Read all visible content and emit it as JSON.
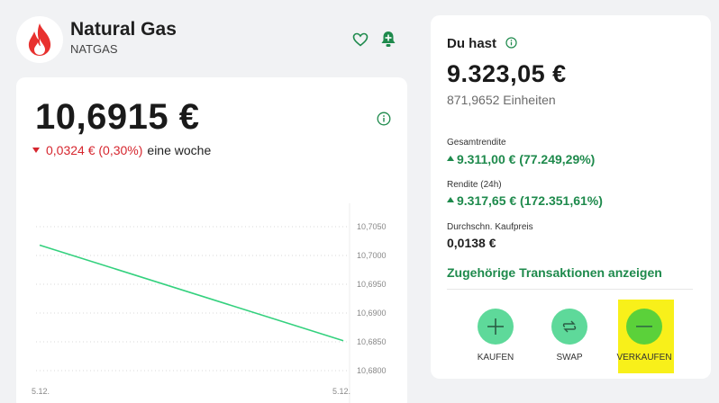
{
  "asset": {
    "name": "Natural Gas",
    "ticker": "NATGAS",
    "favorite_icon": "heart-outline-icon",
    "alert_icon": "bell-plus-icon",
    "logo_icon": "flame-icon",
    "logo_color": "#e8312f"
  },
  "price_panel": {
    "price": "10,6915 €",
    "change": "0,0324 € (0,30%)",
    "period": "eine woche",
    "change_direction": "down",
    "change_color": "#d6262e"
  },
  "chart_data": {
    "type": "line",
    "x": [
      "5.12.",
      "5.12."
    ],
    "series": [
      {
        "values": [
          10.7018,
          10.6852
        ]
      }
    ],
    "y_ticks": [
      "10,7050",
      "10,7000",
      "10,6950",
      "10,6900",
      "10,6850",
      "10,6800"
    ],
    "ylim": [
      10.68,
      10.705
    ],
    "x_tick_labels": [
      "5.12.",
      "5.12."
    ],
    "line_color": "#34d17e",
    "grid": "dotted horizontal"
  },
  "holdings": {
    "title": "Du hast",
    "value": "9.323,05 €",
    "units": "871,9652 Einheiten",
    "total_return_label": "Gesamtrendite",
    "total_return_value": "9.311,00 € (77.249,29%)",
    "return_24h_label": "Rendite (24h)",
    "return_24h_value": "9.317,65 € (172.351,61%)",
    "avg_price_label": "Durchschn. Kaufpreis",
    "avg_price_value": "0,0138 €",
    "transactions_link": "Zugehörige Transaktionen anzeigen",
    "positive_color": "#1e8a4c"
  },
  "actions": {
    "buy": "KAUFEN",
    "swap": "SWAP",
    "sell": "VERKAUFEN",
    "buy_icon": "plus-icon",
    "swap_icon": "swap-arrows-icon",
    "sell_icon": "minus-icon",
    "highlight_color": "#f8f01a"
  }
}
